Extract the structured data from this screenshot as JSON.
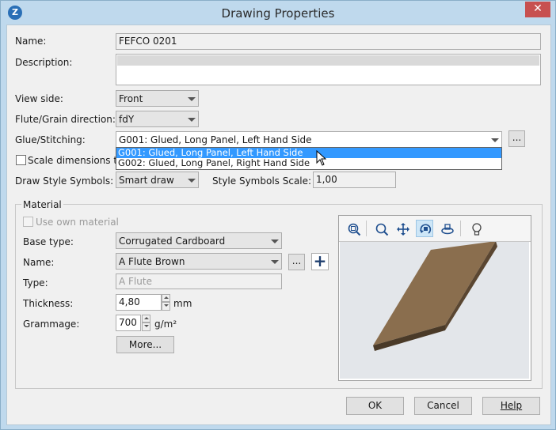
{
  "window": {
    "title": "Drawing Properties",
    "close_glyph": "✕",
    "app_icon_glyph": "Z"
  },
  "fields": {
    "name_label": "Name:",
    "name_value": "FEFCO 0201",
    "description_label": "Description:",
    "description_value": "",
    "view_side_label": "View side:",
    "view_side_value": "Front",
    "flute_label": "Flute/Grain direction:",
    "flute_value": "fdY",
    "glue_label": "Glue/Stitching:",
    "glue_value": "G001: Glued, Long Panel, Left Hand Side",
    "glue_more_label": "...",
    "scale_label": "Scale dimensions to:",
    "draw_style_label": "Draw Style Symbols:",
    "draw_style_value": "Smart draw",
    "style_scale_label": "Style Symbols Scale:",
    "style_scale_value": "1,00"
  },
  "glue_dropdown": {
    "options": [
      {
        "label": "G001: Glued, Long Panel, Left Hand Side",
        "selected": true
      },
      {
        "label": "G002: Glued, Long Panel, Right Hand Side",
        "selected": false
      }
    ]
  },
  "material": {
    "group_title": "Material",
    "use_own_label": "Use own material",
    "base_type_label": "Base type:",
    "base_type_value": "Corrugated Cardboard",
    "name_label": "Name:",
    "name_value": "A Flute Brown",
    "name_more_label": "...",
    "add_glyph": "+",
    "type_label": "Type:",
    "type_value": "A Flute",
    "thickness_label": "Thickness:",
    "thickness_value": "4,80",
    "thickness_unit": "mm",
    "grammage_label": "Grammage:",
    "grammage_value": "700",
    "grammage_unit": "g/m²",
    "more_button": "More..."
  },
  "preview_tools": [
    "zoom-fit-icon",
    "zoom-icon",
    "pan-icon",
    "rotate-icon",
    "orbit-icon",
    "light-bulb-icon"
  ],
  "buttons": {
    "ok": "OK",
    "cancel": "Cancel",
    "help": "Help"
  },
  "colors": {
    "selection": "#3399ff",
    "title_bar": "#bfd9ed",
    "close": "#c75050",
    "board": "#8a6e4e"
  }
}
